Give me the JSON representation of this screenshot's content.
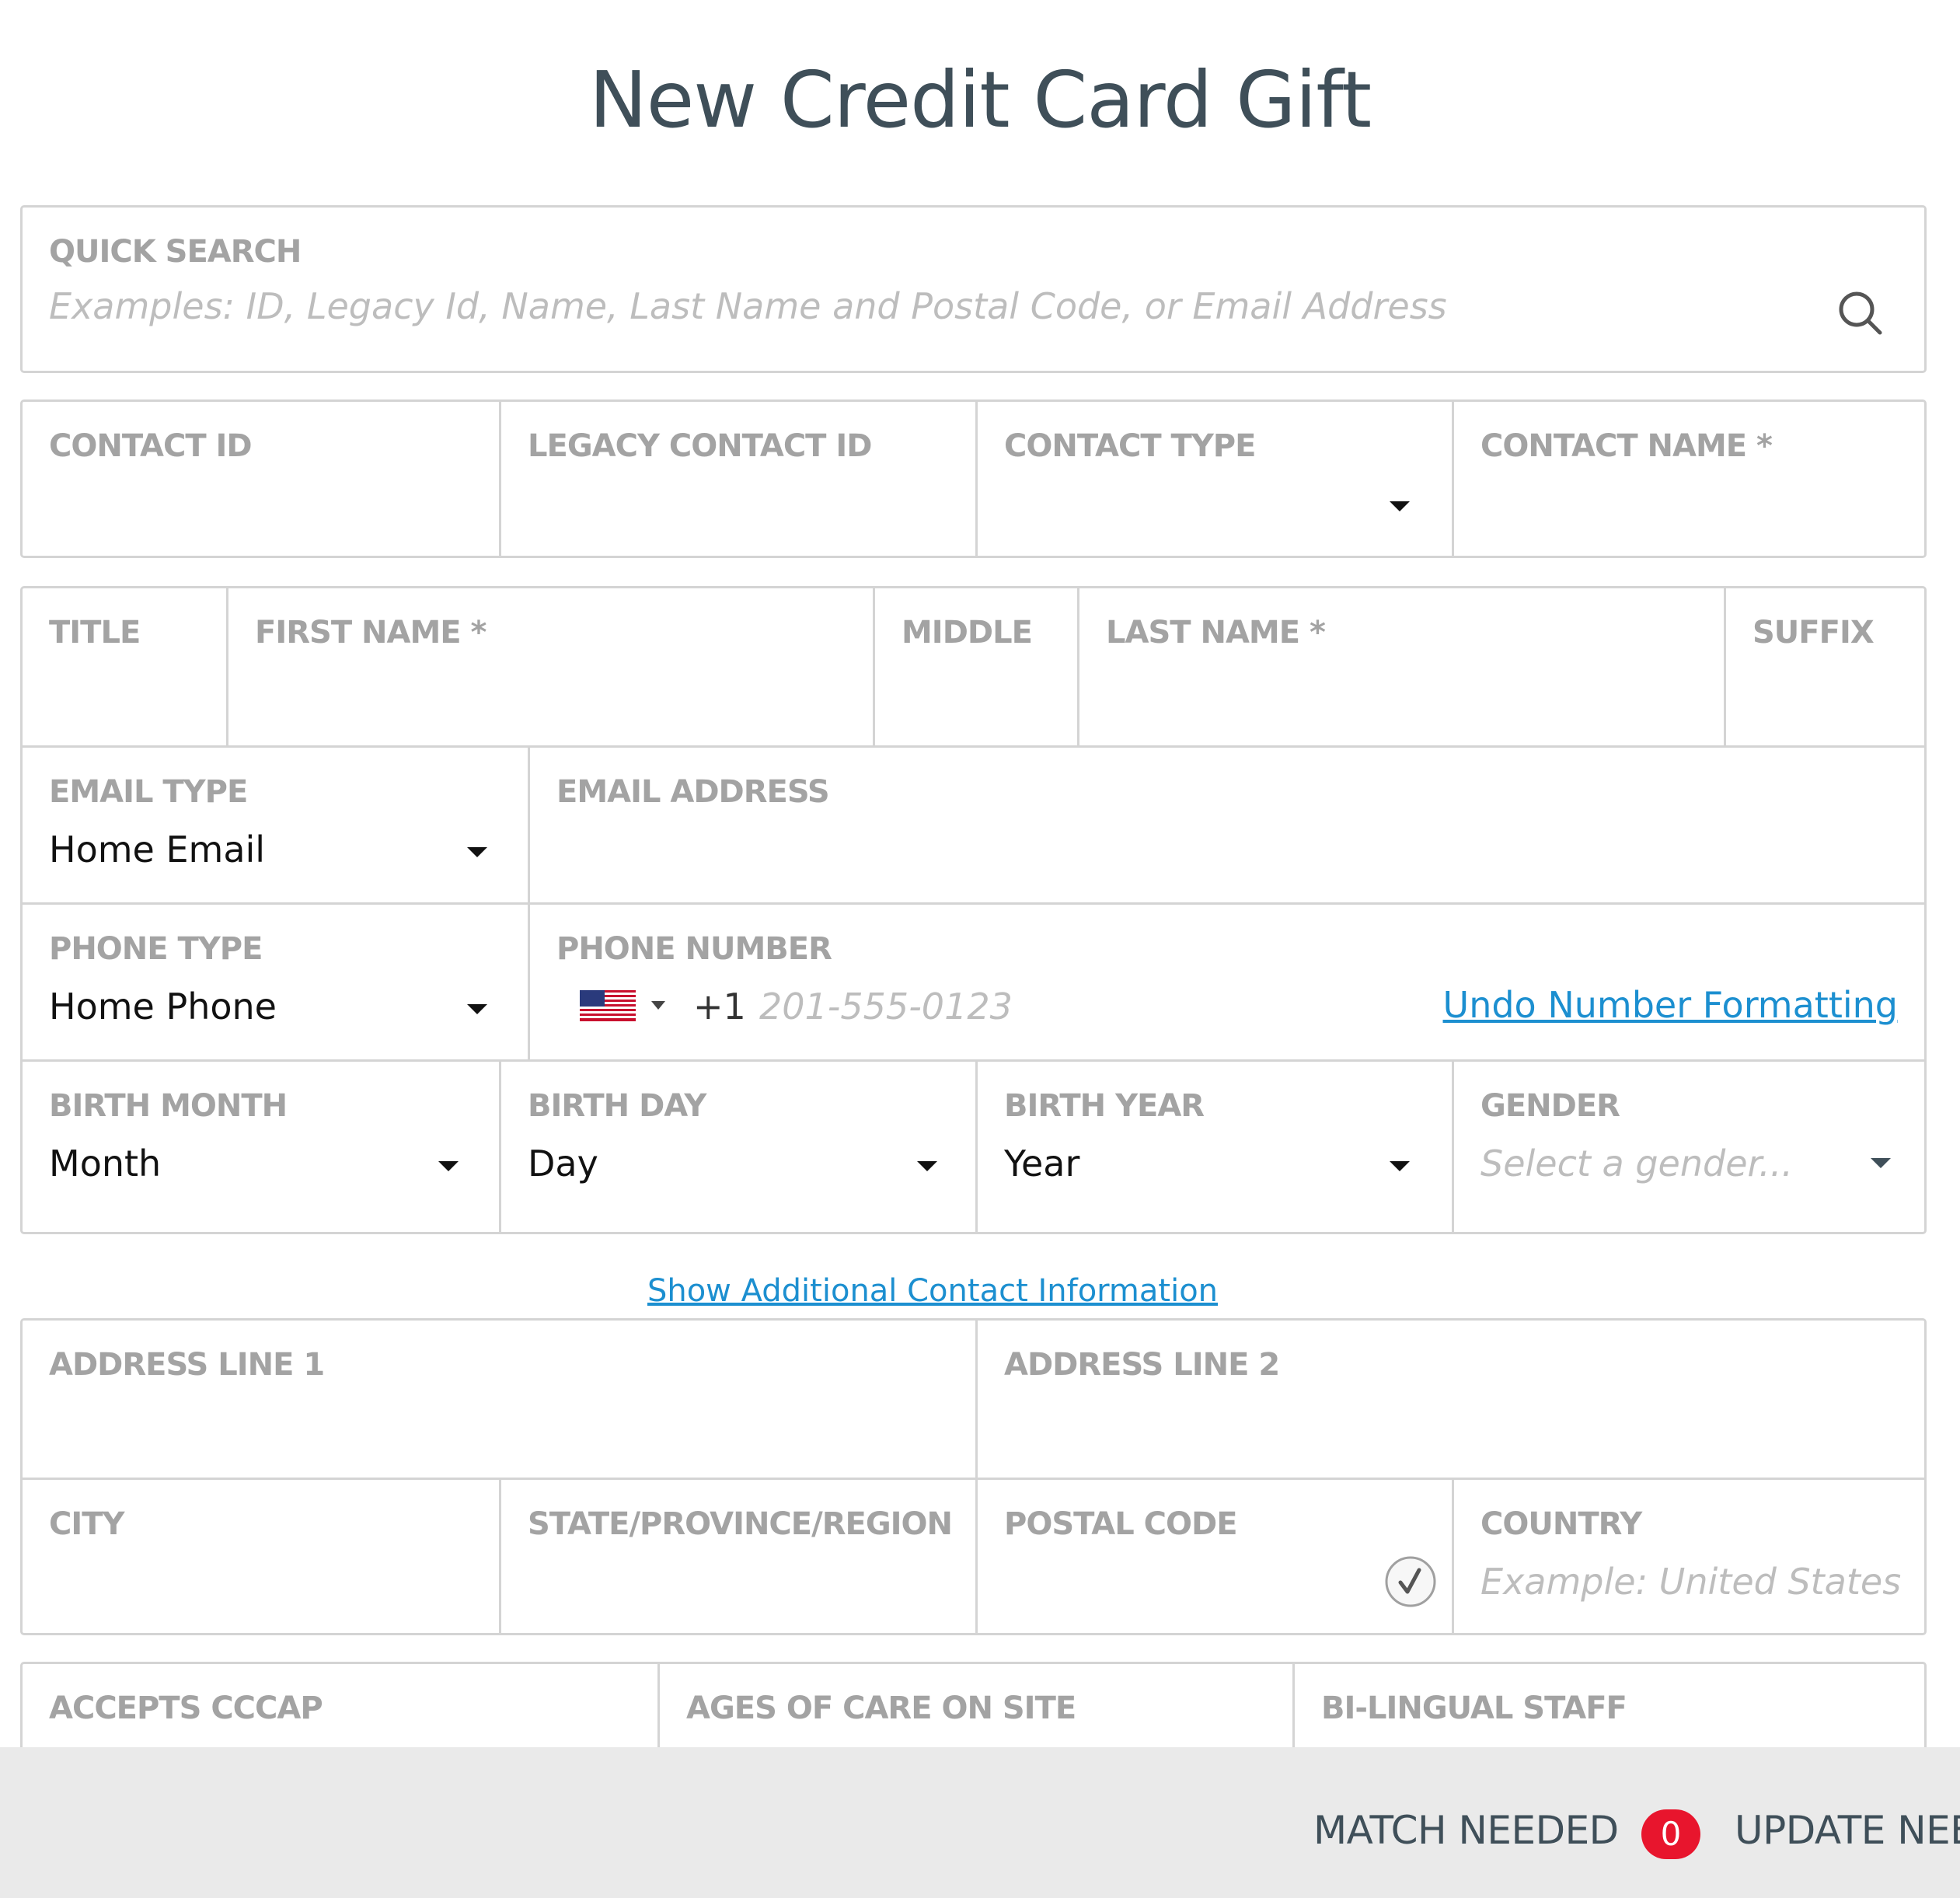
{
  "page": {
    "title": "New Credit Card Gift"
  },
  "quick_search": {
    "label": "QUICK SEARCH",
    "placeholder": "Examples: ID, Legacy Id, Name, Last Name and Postal Code, or Email Address",
    "icon": "search-icon"
  },
  "contact": {
    "contact_id_label": "CONTACT ID",
    "legacy_contact_id_label": "LEGACY CONTACT ID",
    "contact_type_label": "CONTACT TYPE",
    "contact_name_label": "CONTACT NAME *"
  },
  "name": {
    "title_label": "TITLE",
    "first_name_label": "FIRST NAME *",
    "middle_label": "MIDDLE",
    "last_name_label": "LAST NAME *",
    "suffix_label": "SUFFIX"
  },
  "email": {
    "type_label": "EMAIL TYPE",
    "type_value": "Home Email",
    "address_label": "EMAIL ADDRESS"
  },
  "phone": {
    "type_label": "PHONE TYPE",
    "type_value": "Home Phone",
    "number_label": "PHONE NUMBER",
    "country_code": "+1",
    "placeholder": "201-555-0123",
    "undo_link": "Undo Number Formatting",
    "flag_icon": "us-flag-icon"
  },
  "birth": {
    "month_label": "BIRTH MONTH",
    "month_value": "Month",
    "day_label": "BIRTH DAY",
    "day_value": "Day",
    "year_label": "BIRTH YEAR",
    "year_value": "Year",
    "gender_label": "GENDER",
    "gender_placeholder": "Select a gender..."
  },
  "show_more_link": "Show Additional Contact Information",
  "address": {
    "line1_label": "ADDRESS LINE 1",
    "line2_label": "ADDRESS LINE 2",
    "city_label": "CITY",
    "state_label": "STATE/PROVINCE/REGION",
    "postal_label": "POSTAL CODE",
    "country_label": "COUNTRY",
    "country_placeholder": "Example: United States",
    "postal_verify_icon": "checkmark-circle-icon"
  },
  "custom": {
    "accepts_cccap_label": "ACCEPTS CCCAP",
    "ages_label": "AGES OF CARE ON SITE",
    "bilingual_label": "BI-LINGUAL STAFF"
  },
  "footer": {
    "match_needed_label": "MATCH NEEDED",
    "match_count": "0",
    "update_needed_label": "UPDATE NEE"
  },
  "colors": {
    "title": "#3f4f59",
    "label": "#a3a3a3",
    "border": "#d4d4d4",
    "link": "#1c8fd0",
    "badge": "#e8152d",
    "footer_bg": "#eaeaea"
  }
}
